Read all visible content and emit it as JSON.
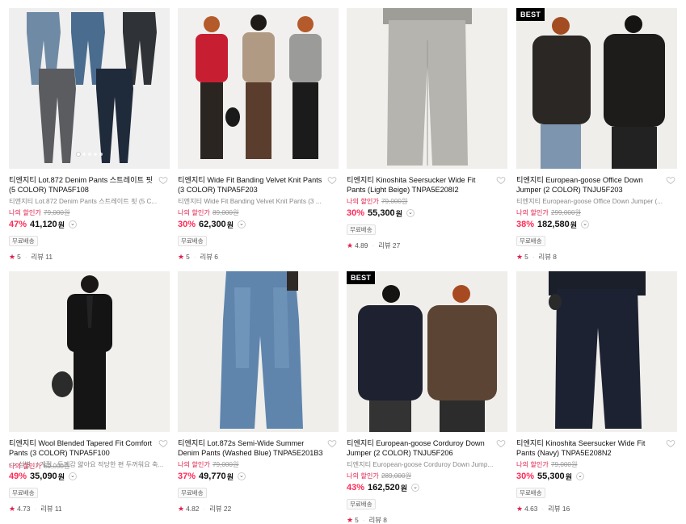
{
  "colors": {
    "accent": "#ff2a55",
    "member_price": "#e0204a",
    "badge_bg": "#000000"
  },
  "products": [
    {
      "title": "티엔지티 Lot.872 Denim Pants 스트레이트 핏 (5 COLOR) TNPA5F108",
      "subtitle": "티엔지티 Lot.872 Denim Pants 스트레이트 핏 (5 C...",
      "member_label": "나의 할인가",
      "original_price": "79,000원",
      "discount": "47%",
      "price": "41,120",
      "currency": "원",
      "shipping": "무료배송",
      "rating": "5",
      "reviews": "리뷰 11",
      "badge": ""
    },
    {
      "title": "티엔지티 Wide Fit Banding Velvet Knit Pants (3 COLOR) TNPA5F203",
      "subtitle": "티엔지티 Wide Fit Banding Velvet Knit Pants (3 ...",
      "member_label": "나의 할인가",
      "original_price": "89,000원",
      "discount": "30%",
      "price": "62,300",
      "currency": "원",
      "shipping": "무료배송",
      "rating": "5",
      "reviews": "리뷰 6",
      "badge": ""
    },
    {
      "title": "티엔지티 Kinoshita Seersucker Wide Fit Pants (Light Beige) TNPA5E208I2",
      "subtitle": "",
      "member_label": "나의 할인가",
      "original_price": "79,000원",
      "discount": "30%",
      "price": "55,300",
      "currency": "원",
      "shipping": "무료배송",
      "rating": "4.89",
      "reviews": "리뷰 27",
      "badge": ""
    },
    {
      "title": "티엔지티 European-goose Office Down Jumper (2 COLOR) TNJU5F203",
      "subtitle": "티엔지티 European-goose Office Down Jumper (...",
      "member_label": "나의 할인가",
      "original_price": "299,000원",
      "discount": "38%",
      "price": "182,580",
      "currency": "원",
      "shipping": "무료배송",
      "rating": "5",
      "reviews": "리뷰 8",
      "badge": "BEST"
    },
    {
      "title": "티엔지티 Wool Blended Tapered Fit Comfort Pants (3 COLOR) TNPA5F100",
      "subtitle": "<> 성별 : / 계절 : 두께감 얇아요 적당한 편 두꺼워요 축...",
      "member_label": "나의 할인가",
      "original_price": "69,000원",
      "discount": "49%",
      "price": "35,090",
      "currency": "원",
      "shipping": "무료배송",
      "rating": "4.73",
      "reviews": "리뷰 11",
      "badge": ""
    },
    {
      "title": "티엔지티 Lot.872s Semi-Wide Summer Denim Pants (Washed Blue) TNPA5E201B3",
      "subtitle": "",
      "member_label": "나의 할인가",
      "original_price": "79,000원",
      "discount": "37%",
      "price": "49,770",
      "currency": "원",
      "shipping": "무료배송",
      "rating": "4.82",
      "reviews": "리뷰 22",
      "badge": ""
    },
    {
      "title": "티엔지티 European-goose Corduroy Down Jumper (2 COLOR) TNJU5F206",
      "subtitle": "티엔지티 European-goose Corduroy Down Jump...",
      "member_label": "나의 할인가",
      "original_price": "289,000원",
      "discount": "43%",
      "price": "162,520",
      "currency": "원",
      "shipping": "무료배송",
      "rating": "5",
      "reviews": "리뷰 8",
      "badge": "BEST"
    },
    {
      "title": "티엔지티 Kinoshita Seersucker Wide Fit Pants (Navy) TNPA5E208N2",
      "subtitle": "",
      "member_label": "나의 할인가",
      "original_price": "79,000원",
      "discount": "30%",
      "price": "55,300",
      "currency": "원",
      "shipping": "무료배송",
      "rating": "4.63",
      "reviews": "리뷰 16",
      "badge": ""
    }
  ]
}
